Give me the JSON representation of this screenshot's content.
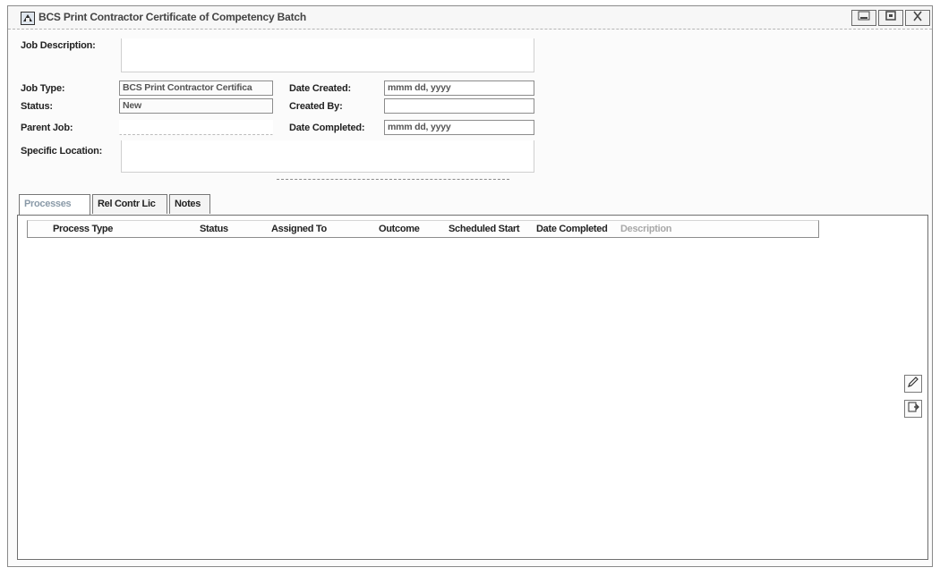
{
  "window": {
    "title": "BCS Print Contractor Certificate of Competency Batch",
    "icons": [
      "app-icon",
      "minimize-icon",
      "maximize-icon",
      "close-icon"
    ]
  },
  "form": {
    "job_description": {
      "label": "Job Description:",
      "value": ""
    },
    "job_type": {
      "label": "Job Type:",
      "value": "BCS Print Contractor Certifica"
    },
    "status": {
      "label": "Status:",
      "value": "New"
    },
    "parent_job": {
      "label": "Parent Job:",
      "value": ""
    },
    "specific_location": {
      "label": "Specific Location:",
      "value": ""
    },
    "date_created": {
      "label": "Date Created:",
      "placeholder": "mmm dd, yyyy"
    },
    "created_by": {
      "label": "Created By:",
      "value": ""
    },
    "date_completed": {
      "label": "Date Completed:",
      "placeholder": "mmm dd, yyyy"
    }
  },
  "tabs": [
    {
      "label": "Processes",
      "active": true
    },
    {
      "label": "Rel Contr Lic",
      "active": false
    },
    {
      "label": "Notes",
      "active": false
    }
  ],
  "table": {
    "columns": [
      "Process Type",
      "Status",
      "Assigned To",
      "Outcome",
      "Scheduled Start",
      "Date Completed",
      "Description"
    ],
    "rows": []
  },
  "side_buttons": [
    "edit-process-icon",
    "add-process-icon"
  ],
  "colors": {
    "window_border": "#8a8a8a",
    "active_tab_text": "#8a9aa8",
    "faded_header": "#a8a8a8"
  }
}
